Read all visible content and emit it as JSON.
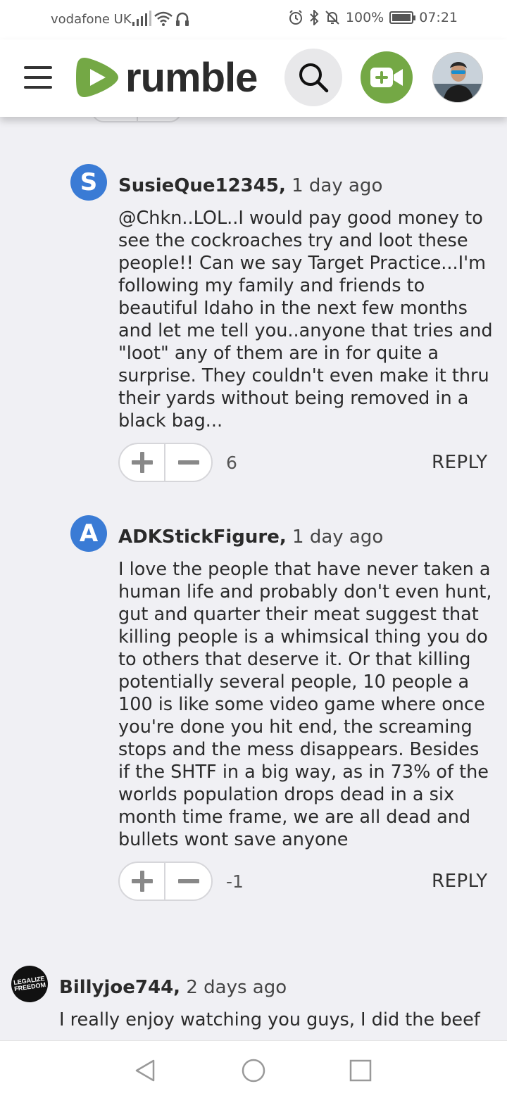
{
  "status_bar": {
    "carrier": "vodafone UK",
    "battery": "100%",
    "time": "07:21"
  },
  "header": {
    "logo_text": "rumble",
    "brand_color": "#74a845"
  },
  "comments": [
    {
      "avatar_letter": "S",
      "author": "SusieQue12345,",
      "time": "1 day ago",
      "lines": [
        "@Chkn..LOL..I would pay good money to",
        "see the cockroaches try and loot these",
        "people!! Can we say Target Practice...I'm",
        "following my family and friends to",
        "beautiful Idaho in the next few months",
        "and let me tell you..anyone that tries and",
        "\"loot\" any of them are in for quite a",
        "surprise. They couldn't even make it thru",
        "their yards without being removed in a",
        "black bag..."
      ],
      "score": "6",
      "reply_label": "REPLY"
    },
    {
      "avatar_letter": "A",
      "author": "ADKStickFigure,",
      "time": "1 day ago",
      "lines": [
        "I love the people that have never taken a",
        "human life and probably don't even hunt,",
        "gut and quarter their meat suggest that",
        "killing people is a whimsical thing you do",
        "to others that deserve it. Or that killing",
        "potentially several people, 10 people a",
        "100 is like some video game where once",
        "you're done you hit end, the screaming",
        "stops and the mess disappears. Besides",
        "if the SHTF in a big way, as in 73% of the",
        "worlds population drops dead in a six",
        "month time frame, we are all dead and",
        "bullets wont save anyone"
      ],
      "score": "-1",
      "reply_label": "REPLY"
    },
    {
      "avatar_text": [
        "LEGALIZE",
        "FREEDOM"
      ],
      "author": "Billyjoe744,",
      "time": "2 days ago",
      "lines": [
        "I really enjoy watching you guys, I did the beef"
      ]
    }
  ]
}
